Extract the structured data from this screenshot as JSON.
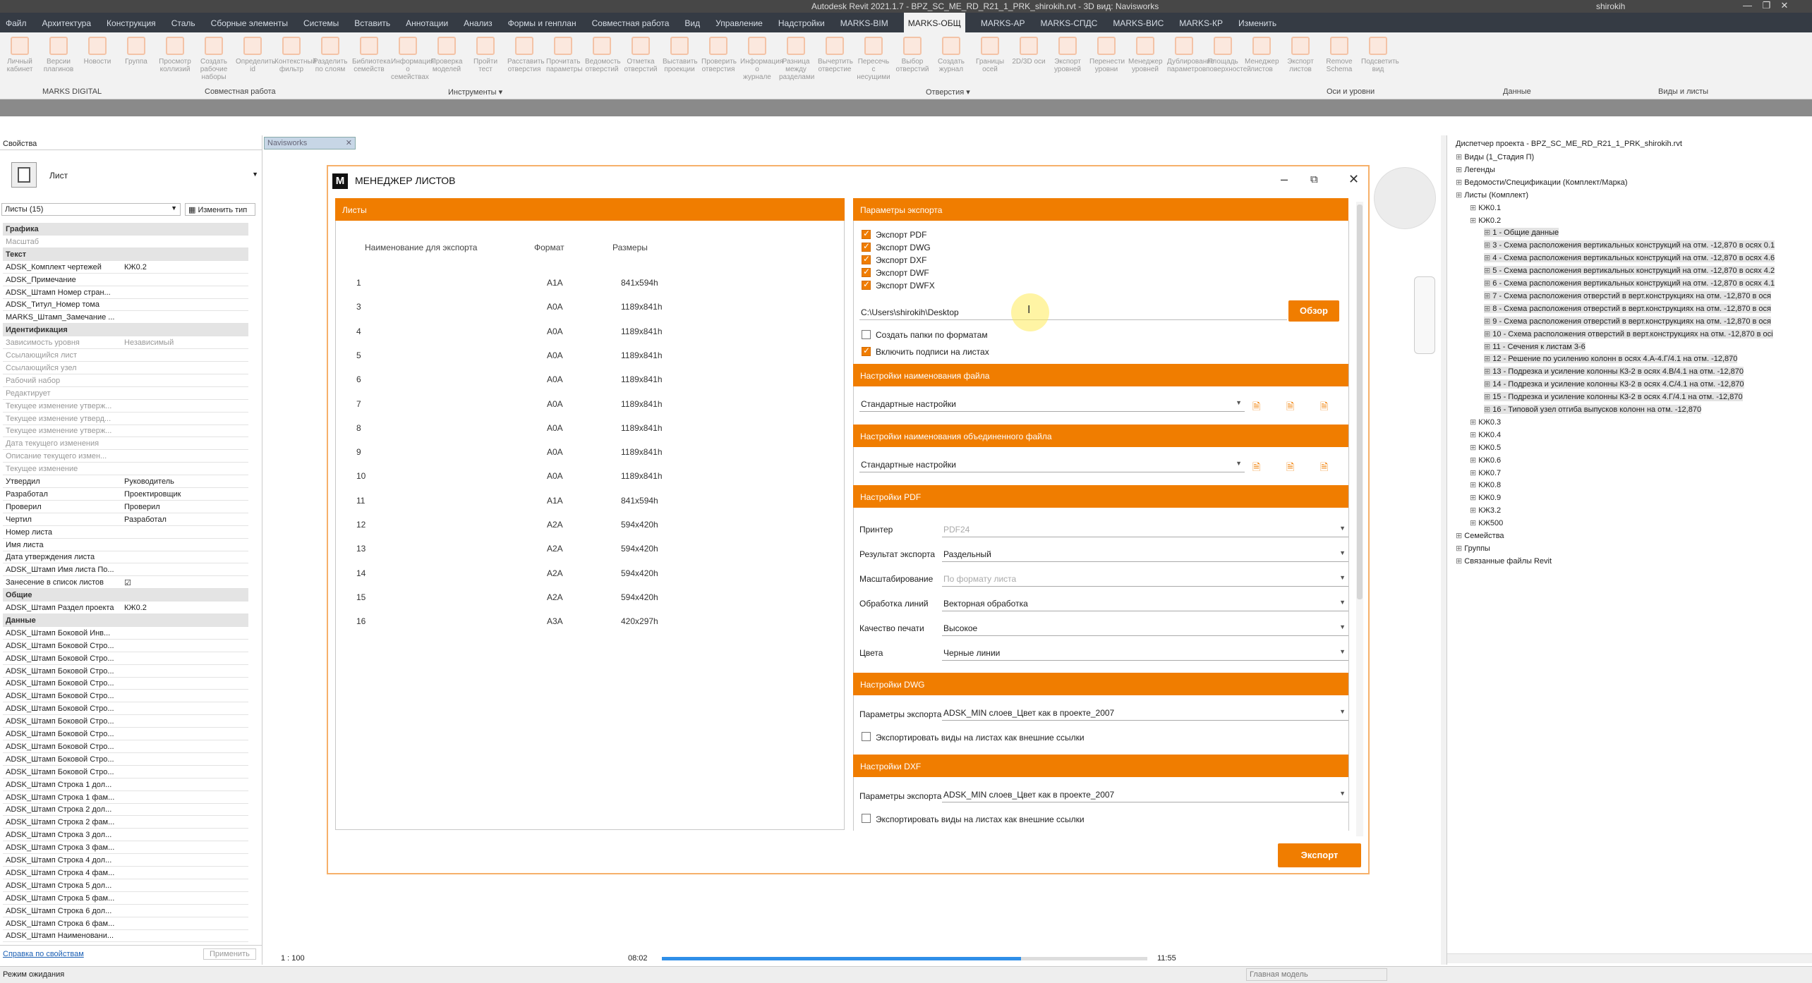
{
  "window": {
    "title": "Autodesk Revit 2021.1.7 - BPZ_SC_ME_RD_R21_1_PRK_shirokih.rvt - 3D вид: Navisworks",
    "user": "shirokih"
  },
  "menu": [
    "Файл",
    "Архитектура",
    "Конструкция",
    "Сталь",
    "Сборные элементы",
    "Системы",
    "Вставить",
    "Аннотации",
    "Анализ",
    "Формы и генплан",
    "Совместная работа",
    "Вид",
    "Управление",
    "Надстройки",
    "MARKS-BIM",
    "MARKS-ОБЩ",
    "MARKS-АР",
    "MARKS-СПДС",
    "MARKS-ВИС",
    "MARKS-КР",
    "Изменить"
  ],
  "ribbon": {
    "buttons": [
      "Личный кабинет",
      "Версии плагинов",
      "Новости",
      "Группа",
      "Просмотр коллизий",
      "Создать рабочие наборы",
      "Определить id",
      "Контекстный фильтр",
      "Разделить по слоям",
      "Библиотека семейств",
      "Информация о семействах",
      "Проверка моделей",
      "Пройти тест",
      "Расставить отверстия",
      "Прочитать параметры",
      "Ведомость отверстий",
      "Отметка отверстий",
      "Выставить проекции",
      "Проверить отверстия",
      "Информация о журнале",
      "Разница между разделами",
      "Вычертить отверстие",
      "Пересечь с несущими",
      "Выбор отверстий",
      "Создать журнал",
      "Границы осей",
      "2D/3D оси",
      "Экспорт уровней",
      "Перенести уровни",
      "Менеджер уровней",
      "Дублирование параметров",
      "Площадь поверхностей",
      "Менеджер листов",
      "Экспорт листов",
      "Remove Schema",
      "Подсветить вид"
    ],
    "groups": [
      "MARKS DIGITAL",
      "Совместная работа",
      "Инструменты ▾",
      "Отверстия ▾",
      "Оси и уровни",
      "Данные",
      "Виды и листы"
    ]
  },
  "properties": {
    "header": "Свойства",
    "type_name": "Лист",
    "filter": "Листы (15)",
    "edit_type": "Изменить тип",
    "rows": [
      {
        "k": "Графика",
        "v": "",
        "t": "hdr"
      },
      {
        "k": "Масштаб",
        "v": "",
        "t": "gray"
      },
      {
        "k": "Текст",
        "v": "",
        "t": "hdr"
      },
      {
        "k": "ADSK_Комплект чертежей",
        "v": "КЖ0.2",
        "t": ""
      },
      {
        "k": "ADSK_Примечание",
        "v": "",
        "t": ""
      },
      {
        "k": "ADSK_Штамп Номер стран...",
        "v": "",
        "t": ""
      },
      {
        "k": "ADSK_Титул_Номер тома",
        "v": "",
        "t": ""
      },
      {
        "k": "MARKS_Штамп_Замечание ...",
        "v": "",
        "t": ""
      },
      {
        "k": "Идентификация",
        "v": "",
        "t": "hdr"
      },
      {
        "k": "Зависимость уровня",
        "v": "Независимый",
        "t": "gray"
      },
      {
        "k": "Ссылающийся лист",
        "v": "",
        "t": "gray"
      },
      {
        "k": "Ссылающийся узел",
        "v": "",
        "t": "gray"
      },
      {
        "k": "Рабочий набор",
        "v": "",
        "t": "gray"
      },
      {
        "k": "Редактирует",
        "v": "",
        "t": "gray"
      },
      {
        "k": "Текущее изменение утверж...",
        "v": "",
        "t": "gray"
      },
      {
        "k": "Текущее изменение утверд...",
        "v": "",
        "t": "gray"
      },
      {
        "k": "Текущее изменение утверж...",
        "v": "",
        "t": "gray"
      },
      {
        "k": "Дата текущего изменения",
        "v": "",
        "t": "gray"
      },
      {
        "k": "Описание текущего измен...",
        "v": "",
        "t": "gray"
      },
      {
        "k": "Текущее изменение",
        "v": "",
        "t": "gray"
      },
      {
        "k": "Утвердил",
        "v": "Руководитель",
        "t": ""
      },
      {
        "k": "Разработал",
        "v": "Проектировщик",
        "t": ""
      },
      {
        "k": "Проверил",
        "v": "Проверил",
        "t": ""
      },
      {
        "k": "Чертил",
        "v": "Разработал",
        "t": ""
      },
      {
        "k": "Номер листа",
        "v": "",
        "t": ""
      },
      {
        "k": "Имя листа",
        "v": "",
        "t": ""
      },
      {
        "k": "Дата утверждения листа",
        "v": "",
        "t": ""
      },
      {
        "k": "ADSK_Штамп Имя листа По...",
        "v": "",
        "t": ""
      },
      {
        "k": "Занесение в список листов",
        "v": "☑",
        "t": ""
      },
      {
        "k": "Общие",
        "v": "",
        "t": "hdr"
      },
      {
        "k": "ADSK_Штамп Раздел проекта",
        "v": "КЖ0.2",
        "t": ""
      },
      {
        "k": "Данные",
        "v": "",
        "t": "hdr"
      },
      {
        "k": "ADSK_Штамп Боковой Инв...",
        "v": "",
        "t": ""
      },
      {
        "k": "ADSK_Штамп Боковой Стро...",
        "v": "",
        "t": ""
      },
      {
        "k": "ADSK_Штамп Боковой Стро...",
        "v": "",
        "t": ""
      },
      {
        "k": "ADSK_Штамп Боковой Стро...",
        "v": "",
        "t": ""
      },
      {
        "k": "ADSK_Штамп Боковой Стро...",
        "v": "",
        "t": ""
      },
      {
        "k": "ADSK_Штамп Боковой Стро...",
        "v": "",
        "t": ""
      },
      {
        "k": "ADSK_Штамп Боковой Стро...",
        "v": "",
        "t": ""
      },
      {
        "k": "ADSK_Штамп Боковой Стро...",
        "v": "",
        "t": ""
      },
      {
        "k": "ADSK_Штамп Боковой Стро...",
        "v": "",
        "t": ""
      },
      {
        "k": "ADSK_Штамп Боковой Стро...",
        "v": "",
        "t": ""
      },
      {
        "k": "ADSK_Штамп Боковой Стро...",
        "v": "",
        "t": ""
      },
      {
        "k": "ADSK_Штамп Боковой Стро...",
        "v": "",
        "t": ""
      },
      {
        "k": "ADSK_Штамп Строка 1 дол...",
        "v": "",
        "t": ""
      },
      {
        "k": "ADSK_Штамп Строка 1 фам...",
        "v": "",
        "t": ""
      },
      {
        "k": "ADSK_Штамп Строка 2 дол...",
        "v": "",
        "t": ""
      },
      {
        "k": "ADSK_Штамп Строка 2 фам...",
        "v": "",
        "t": ""
      },
      {
        "k": "ADSK_Штамп Строка 3 дол...",
        "v": "",
        "t": ""
      },
      {
        "k": "ADSK_Штамп Строка 3 фам...",
        "v": "",
        "t": ""
      },
      {
        "k": "ADSK_Штамп Строка 4 дол...",
        "v": "",
        "t": ""
      },
      {
        "k": "ADSK_Штамп Строка 4 фам...",
        "v": "",
        "t": ""
      },
      {
        "k": "ADSK_Штамп Строка 5 дол...",
        "v": "",
        "t": ""
      },
      {
        "k": "ADSK_Штамп Строка 5 фам...",
        "v": "",
        "t": ""
      },
      {
        "k": "ADSK_Штамп Строка 6 дол...",
        "v": "",
        "t": ""
      },
      {
        "k": "ADSK_Штамп Строка 6 фам...",
        "v": "",
        "t": ""
      },
      {
        "k": "ADSK_Штамп Наименовани...",
        "v": "",
        "t": ""
      }
    ],
    "help_link": "Справка по свойствам",
    "apply": "Применить"
  },
  "view_tab": "Navisworks",
  "browser": {
    "title": "Диспетчер проекта - BPZ_SC_ME_RD_R21_1_PRK_shirokih.rvt",
    "nodes": [
      {
        "t": "Виды (1_Стадия П)",
        "l": 0,
        "s": 0
      },
      {
        "t": "Легенды",
        "l": 0,
        "s": 0
      },
      {
        "t": "Ведомости/Спецификации (Комплект/Марка)",
        "l": 0,
        "s": 0
      },
      {
        "t": "Листы (Комплект)",
        "l": 0,
        "s": 0
      },
      {
        "t": "КЖ0.1",
        "l": 1,
        "s": 0
      },
      {
        "t": "КЖ0.2",
        "l": 1,
        "s": 0
      },
      {
        "t": "1 - Общие данные",
        "l": 2,
        "s": 1
      },
      {
        "t": "3 - Схема расположения вертикальных конструкций на отм. -12,870 в осях 0.1",
        "l": 2,
        "s": 1
      },
      {
        "t": "4 - Схема расположения вертикальных конструкций на отм. -12,870 в осях 4.6",
        "l": 2,
        "s": 1
      },
      {
        "t": "5 - Схема расположения вертикальных конструкций на отм. -12,870 в осях 4.2",
        "l": 2,
        "s": 1
      },
      {
        "t": "6 - Схема расположения вертикальных конструкций на отм. -12,870 в осях 4.1",
        "l": 2,
        "s": 1
      },
      {
        "t": "7 - Схема расположения отверстий в верт.конструкциях на отм. -12,870 в ося",
        "l": 2,
        "s": 1
      },
      {
        "t": "8 - Схема расположения отверстий в верт.конструкциях на отм. -12,870 в ося",
        "l": 2,
        "s": 1
      },
      {
        "t": "9 - Схема расположения отверстий в верт.конструкциях на отм. -12,870 в ося",
        "l": 2,
        "s": 1
      },
      {
        "t": "10 - Схема расположения отверстий в верт.конструкциях на отм. -12,870 в осі",
        "l": 2,
        "s": 1
      },
      {
        "t": "11 - Сечения к листам 3-6",
        "l": 2,
        "s": 1
      },
      {
        "t": "12 - Решение по усилению колонн в осях 4.А-4.Г/4.1 на отм. -12,870",
        "l": 2,
        "s": 1
      },
      {
        "t": "13 - Подрезка и усиление колонны К3-2 в осях 4.В/4.1 на отм. -12,870",
        "l": 2,
        "s": 1
      },
      {
        "t": "14 - Подрезка и усиление колонны К3-2 в осях 4.С/4.1 на отм. -12,870",
        "l": 2,
        "s": 1
      },
      {
        "t": "15 - Подрезка и усиление колонны К3-2 в осях 4.Г/4.1 на отм. -12,870",
        "l": 2,
        "s": 1
      },
      {
        "t": "16 - Типовой узел отгиба выпусков колонн на отм. -12,870",
        "l": 2,
        "s": 1
      },
      {
        "t": "КЖ0.3",
        "l": 1,
        "s": 0
      },
      {
        "t": "КЖ0.4",
        "l": 1,
        "s": 0
      },
      {
        "t": "КЖ0.5",
        "l": 1,
        "s": 0
      },
      {
        "t": "КЖ0.6",
        "l": 1,
        "s": 0
      },
      {
        "t": "КЖ0.7",
        "l": 1,
        "s": 0
      },
      {
        "t": "КЖ0.8",
        "l": 1,
        "s": 0
      },
      {
        "t": "КЖ0.9",
        "l": 1,
        "s": 0
      },
      {
        "t": "КЖ3.2",
        "l": 1,
        "s": 0
      },
      {
        "t": "КЖ500",
        "l": 1,
        "s": 0
      },
      {
        "t": "Семейства",
        "l": 0,
        "s": 0
      },
      {
        "t": "Группы",
        "l": 0,
        "s": 0
      },
      {
        "t": "Связанные файлы Revit",
        "l": 0,
        "s": 0
      }
    ]
  },
  "dialog": {
    "title": "МЕНЕДЖЕР ЛИСТОВ",
    "sheets_header": "Листы",
    "columns": [
      "Наименование для экспорта",
      "Формат",
      "Размеры"
    ],
    "rows": [
      [
        "1",
        "A1A",
        "841x594h"
      ],
      [
        "3",
        "A0A",
        "1189x841h"
      ],
      [
        "4",
        "A0A",
        "1189x841h"
      ],
      [
        "5",
        "A0A",
        "1189x841h"
      ],
      [
        "6",
        "A0A",
        "1189x841h"
      ],
      [
        "7",
        "A0A",
        "1189x841h"
      ],
      [
        "8",
        "A0A",
        "1189x841h"
      ],
      [
        "9",
        "A0A",
        "1189x841h"
      ],
      [
        "10",
        "A0A",
        "1189x841h"
      ],
      [
        "11",
        "A1A",
        "841x594h"
      ],
      [
        "12",
        "A2A",
        "594x420h"
      ],
      [
        "13",
        "A2A",
        "594x420h"
      ],
      [
        "14",
        "A2A",
        "594x420h"
      ],
      [
        "15",
        "A2A",
        "594x420h"
      ],
      [
        "16",
        "A3A",
        "420x297h"
      ]
    ],
    "export_params": "Параметры экспорта",
    "formats": [
      {
        "label": "Экспорт PDF",
        "on": true
      },
      {
        "label": "Экспорт DWG",
        "on": true
      },
      {
        "label": "Экспорт DXF",
        "on": true
      },
      {
        "label": "Экспорт DWF",
        "on": true
      },
      {
        "label": "Экспорт DWFX",
        "on": true
      }
    ],
    "path": "C:\\Users\\shirokih\\Desktop",
    "browse": "Обзор",
    "create_folders": "Создать папки по форматам",
    "include_captions": "Включить подписи на листах",
    "file_naming": "Настройки наименования файла",
    "file_naming_value": "Стандартные настройки",
    "merged_naming": "Настройки наименования объединенного файла",
    "merged_naming_value": "Стандартные настройки",
    "pdf_settings": "Настройки PDF",
    "pdf_fields": [
      {
        "k": "Принтер",
        "v": "PDF24",
        "dis": true
      },
      {
        "k": "Результат экспорта",
        "v": "Раздельный",
        "dis": false
      },
      {
        "k": "Масштабирование",
        "v": "По формату листа",
        "dis": true
      },
      {
        "k": "Обработка линий",
        "v": "Векторная обработка",
        "dis": false
      },
      {
        "k": "Качество печати",
        "v": "Высокое",
        "dis": false
      },
      {
        "k": "Цвета",
        "v": "Черные линии",
        "dis": false
      }
    ],
    "dwg_settings": "Настройки DWG",
    "dwg_params_label": "Параметры экспорта",
    "dwg_params_value": "ADSK_MIN слоев_Цвет как в проекте_2007",
    "dwg_external": "Экспортировать виды на листах как внешние ссылки",
    "dxf_settings": "Настройки DXF",
    "dxf_params_label": "Параметры экспорта",
    "dxf_params_value": "ADSK_MIN слоев_Цвет как в проекте_2007",
    "dxf_external": "Экспортировать виды на листах как внешние ссылки",
    "export": "Экспорт"
  },
  "status": {
    "text": "Режим ожидания",
    "scale": "1 : 100",
    "time_start": "08:02",
    "time_end": "11:55",
    "progress": 0.74,
    "model": "Главная модель"
  }
}
